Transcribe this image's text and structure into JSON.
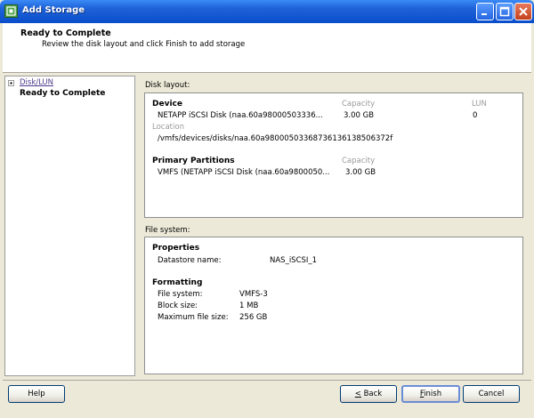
{
  "window": {
    "title": "Add Storage"
  },
  "header": {
    "title": "Ready to Complete",
    "subtitle": "Review the disk layout and click Finish to add storage"
  },
  "sidebar": {
    "items": [
      {
        "label": "Disk/LUN",
        "state": "link"
      },
      {
        "label": "Ready to Complete",
        "state": "current"
      }
    ]
  },
  "disk_layout": {
    "label": "Disk layout:",
    "device_header": "Device",
    "capacity_header": "Capacity",
    "lun_header": "LUN",
    "device_name": "NETAPP iSCSI Disk (naa.60a98000503336...",
    "device_capacity": "3.00 GB",
    "device_lun": "0",
    "location_header": "Location",
    "location_value": "/vmfs/devices/disks/naa.60a98000503368736136138506372f",
    "partitions_header": "Primary Partitions",
    "partitions_capacity_header": "Capacity",
    "partition_name": "VMFS (NETAPP iSCSI Disk (naa.60a9800050...",
    "partition_capacity": "3.00 GB"
  },
  "file_system": {
    "label": "File system:",
    "properties_header": "Properties",
    "datastore_label": "Datastore name:",
    "datastore_value": "NAS_iSCSI_1",
    "formatting_header": "Formatting",
    "fs_label": "File system:",
    "fs_value": "VMFS-3",
    "block_label": "Block size:",
    "block_value": "1 MB",
    "maxfile_label": "Maximum file size:",
    "maxfile_value": "256 GB"
  },
  "buttons": {
    "help": "Help",
    "back_mnemonic": "<",
    "back_rest": " Back",
    "finish_mnemonic": "F",
    "finish_rest": "inish",
    "cancel": "Cancel"
  },
  "colors": {
    "titlebar": "#0A4DCB",
    "window_bg": "#ECE9D8",
    "link": "#4D3C8C"
  }
}
